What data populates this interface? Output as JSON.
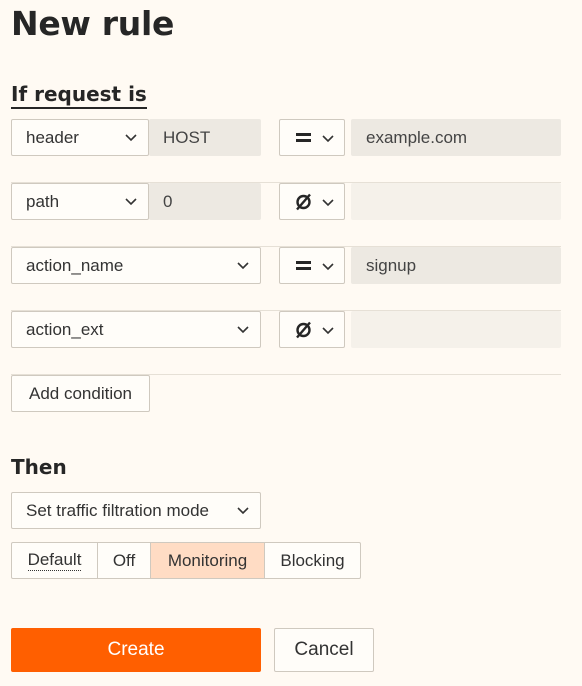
{
  "page": {
    "title": "New rule"
  },
  "condition_section": {
    "title": "If request is"
  },
  "conditions": [
    {
      "field": "header",
      "key": "HOST",
      "operator_icon": "equals-icon",
      "value": "example.com"
    },
    {
      "field": "path",
      "key": "0",
      "operator_icon": "empty-set-icon",
      "value": ""
    },
    {
      "field": "action_name",
      "operator_icon": "equals-icon",
      "value": "signup"
    },
    {
      "field": "action_ext",
      "operator_icon": "empty-set-icon",
      "value": ""
    }
  ],
  "add_condition_label": "Add condition",
  "action_section": {
    "title": "Then",
    "action_select": "Set traffic filtration mode",
    "modes": [
      "Default",
      "Off",
      "Monitoring",
      "Blocking"
    ],
    "selected_mode": "Monitoring"
  },
  "footer": {
    "create_label": "Create",
    "cancel_label": "Cancel"
  },
  "colors": {
    "accent": "#ff5f00",
    "selected_mode_bg": "#ffdcc4",
    "background": "#fffaf3"
  }
}
